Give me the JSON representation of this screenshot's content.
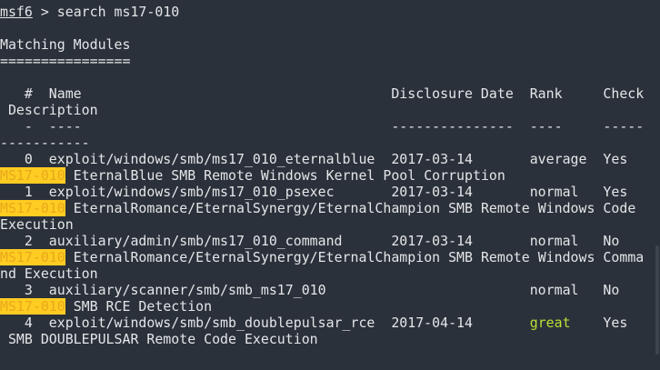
{
  "prompt": {
    "name": "msf6",
    "command": " > search ms17-010"
  },
  "heading": "Matching Modules",
  "underline": "================",
  "header": {
    "line1": "   #  Name                                      Disclosure Date  Rank     Check",
    "line2": " Description",
    "dash1": "   -  ----                                      ---------------  ----     -----",
    "dash2": "-----------"
  },
  "rows": [
    {
      "main": "   0  exploit/windows/smb/ms17_010_eternalblue  2017-03-14       average  Yes",
      "tag": "MS17-010",
      "desc": " EternalBlue SMB Remote Windows Kernel Pool Corruption",
      "desc2": ""
    },
    {
      "main": "   1  exploit/windows/smb/ms17_010_psexec       2017-03-14       normal   Yes",
      "tag": "MS17-010",
      "desc": " EternalRomance/EternalSynergy/EternalChampion SMB Remote Windows Code",
      "desc2": "Execution"
    },
    {
      "main": "   2  auxiliary/admin/smb/ms17_010_command      2017-03-14       normal   No",
      "tag": "MS17-010",
      "desc": " EternalRomance/EternalSynergy/EternalChampion SMB Remote Windows Comma",
      "desc2": "nd Execution"
    },
    {
      "main": "   3  auxiliary/scanner/smb/smb_ms17_010                         normal   No",
      "tag": "MS17-010",
      "desc": " SMB RCE Detection",
      "desc2": ""
    },
    {
      "main_pre": "   4  exploit/windows/smb/smb_doublepulsar_rce  2017-04-14       ",
      "rank": "great",
      "main_post": "    Yes",
      "desc_full": " SMB DOUBLEPULSAR Remote Code Execution"
    }
  ],
  "colors": {
    "background": "#2b313a",
    "foreground": "#e4e6e9",
    "highlight": "#ffcc22",
    "great": "#b8e236"
  }
}
